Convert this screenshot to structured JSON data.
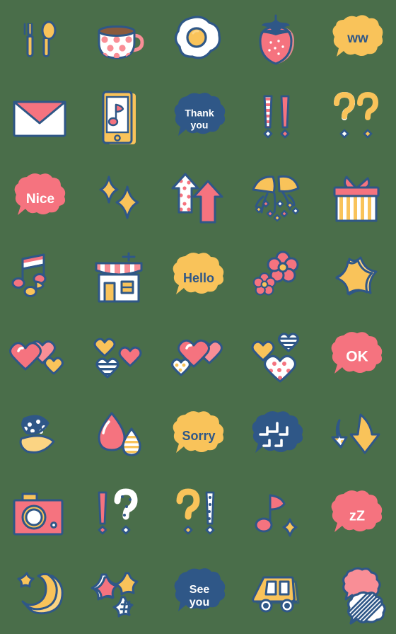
{
  "palette": {
    "background": "#4a6e4a",
    "outline": "#2f5787",
    "pink": "#f5737f",
    "pink_light": "#f98e96",
    "yellow": "#f9c35a",
    "yellow_light": "#fbd483",
    "blue": "#2f5787",
    "white": "#ffffff",
    "brown": "#8a5a3c"
  },
  "grid": {
    "columns": 5,
    "rows": 8,
    "cell_size": 112,
    "total_items": 40
  },
  "items": [
    {
      "row": 1,
      "col": 1,
      "name": "fork-and-spoon-icon",
      "label": "Fork and spoon",
      "text": ""
    },
    {
      "row": 1,
      "col": 2,
      "name": "polka-dot-coffee-cup-icon",
      "label": "Polka dot coffee cup",
      "text": ""
    },
    {
      "row": 1,
      "col": 3,
      "name": "fried-egg-icon",
      "label": "Fried egg",
      "text": ""
    },
    {
      "row": 1,
      "col": 4,
      "name": "strawberry-icon",
      "label": "Strawberry",
      "text": ""
    },
    {
      "row": 1,
      "col": 5,
      "name": "speech-bubble-ww-icon",
      "label": "Yellow speech bubble",
      "text": "ww"
    },
    {
      "row": 2,
      "col": 1,
      "name": "envelope-icon",
      "label": "Envelope",
      "text": ""
    },
    {
      "row": 2,
      "col": 2,
      "name": "smartphone-music-icon",
      "label": "Smartphone with music note",
      "text": ""
    },
    {
      "row": 2,
      "col": 3,
      "name": "speech-bubble-thank-you-icon",
      "label": "Blue speech bubble",
      "text": "Thank you"
    },
    {
      "row": 2,
      "col": 4,
      "name": "double-exclamation-icon",
      "label": "Double exclamation marks",
      "text": ""
    },
    {
      "row": 2,
      "col": 5,
      "name": "double-question-icon",
      "label": "Double question marks",
      "text": ""
    },
    {
      "row": 3,
      "col": 1,
      "name": "speech-bubble-nice-icon",
      "label": "Pink speech bubble",
      "text": "Nice"
    },
    {
      "row": 3,
      "col": 2,
      "name": "sparkles-icon",
      "label": "Sparkles",
      "text": ""
    },
    {
      "row": 3,
      "col": 3,
      "name": "up-arrows-icon",
      "label": "Two up arrows",
      "text": ""
    },
    {
      "row": 3,
      "col": 4,
      "name": "party-popper-icon",
      "label": "Party popper confetti",
      "text": ""
    },
    {
      "row": 3,
      "col": 5,
      "name": "gift-box-icon",
      "label": "Gift box",
      "text": ""
    },
    {
      "row": 4,
      "col": 1,
      "name": "music-notes-icon",
      "label": "Music notes",
      "text": ""
    },
    {
      "row": 4,
      "col": 2,
      "name": "shop-house-icon",
      "label": "Shop with awning",
      "text": ""
    },
    {
      "row": 4,
      "col": 3,
      "name": "speech-bubble-hello-icon",
      "label": "Yellow speech bubble",
      "text": "Hello"
    },
    {
      "row": 4,
      "col": 4,
      "name": "flowers-icon",
      "label": "Two pink flowers",
      "text": ""
    },
    {
      "row": 4,
      "col": 5,
      "name": "star-icon",
      "label": "Yellow star",
      "text": ""
    },
    {
      "row": 5,
      "col": 1,
      "name": "two-hearts-icon",
      "label": "Pink and yellow hearts",
      "text": ""
    },
    {
      "row": 5,
      "col": 2,
      "name": "three-hearts-icon",
      "label": "Three small hearts",
      "text": ""
    },
    {
      "row": 5,
      "col": 3,
      "name": "heart-with-dots-icon",
      "label": "Heart with dotted heart",
      "text": ""
    },
    {
      "row": 5,
      "col": 4,
      "name": "heart-cluster-icon",
      "label": "Cluster of patterned hearts",
      "text": ""
    },
    {
      "row": 5,
      "col": 5,
      "name": "speech-bubble-ok-icon",
      "label": "Pink speech bubble",
      "text": "OK"
    },
    {
      "row": 6,
      "col": 1,
      "name": "leaves-icon",
      "label": "Patterned leaves",
      "text": ""
    },
    {
      "row": 6,
      "col": 2,
      "name": "water-drops-icon",
      "label": "Water drops",
      "text": ""
    },
    {
      "row": 6,
      "col": 3,
      "name": "speech-bubble-sorry-icon",
      "label": "Yellow speech bubble",
      "text": "Sorry"
    },
    {
      "row": 6,
      "col": 4,
      "name": "speech-bubble-anger-icon",
      "label": "Blue anger bubble",
      "text": ""
    },
    {
      "row": 6,
      "col": 5,
      "name": "down-arrows-icon",
      "label": "Two down arrows",
      "text": ""
    },
    {
      "row": 7,
      "col": 1,
      "name": "camera-icon",
      "label": "Pink camera",
      "text": ""
    },
    {
      "row": 7,
      "col": 2,
      "name": "exclamation-question-icon",
      "label": "Exclamation and question mark",
      "text": ""
    },
    {
      "row": 7,
      "col": 3,
      "name": "question-exclamation-icon",
      "label": "Question and exclamation mark",
      "text": ""
    },
    {
      "row": 7,
      "col": 4,
      "name": "music-note-sparkle-icon",
      "label": "Music note with sparkle",
      "text": ""
    },
    {
      "row": 7,
      "col": 5,
      "name": "speech-bubble-zz-icon",
      "label": "Pink sleeping bubble",
      "text": "zZ"
    },
    {
      "row": 8,
      "col": 1,
      "name": "crescent-moon-star-icon",
      "label": "Crescent moon and star",
      "text": ""
    },
    {
      "row": 8,
      "col": 2,
      "name": "three-stars-icon",
      "label": "Three stars",
      "text": ""
    },
    {
      "row": 8,
      "col": 3,
      "name": "speech-bubble-see-you-icon",
      "label": "Blue speech bubble",
      "text": "See you"
    },
    {
      "row": 8,
      "col": 4,
      "name": "car-icon",
      "label": "Yellow car",
      "text": ""
    },
    {
      "row": 8,
      "col": 5,
      "name": "two-speech-bubbles-icon",
      "label": "Pink and striped speech bubbles",
      "text": ""
    }
  ],
  "bubbles": {
    "ww": {
      "text": "ww",
      "fill": "#f9c35a",
      "color": "#2f5787"
    },
    "thank_you": {
      "line1": "Thank",
      "line2": "you",
      "fill": "#2f5787",
      "color": "#ffffff"
    },
    "nice": {
      "text": "Nice",
      "fill": "#f5737f",
      "color": "#ffffff"
    },
    "hello": {
      "text": "Hello",
      "fill": "#f9c35a",
      "color": "#2f5787"
    },
    "ok": {
      "text": "OK",
      "fill": "#f5737f",
      "color": "#ffffff"
    },
    "sorry": {
      "text": "Sorry",
      "fill": "#f9c35a",
      "color": "#2f5787"
    },
    "zz": {
      "text": "zZ",
      "fill": "#f5737f",
      "color": "#ffffff"
    },
    "see_you": {
      "line1": "See",
      "line2": "you",
      "fill": "#2f5787",
      "color": "#ffffff"
    }
  }
}
